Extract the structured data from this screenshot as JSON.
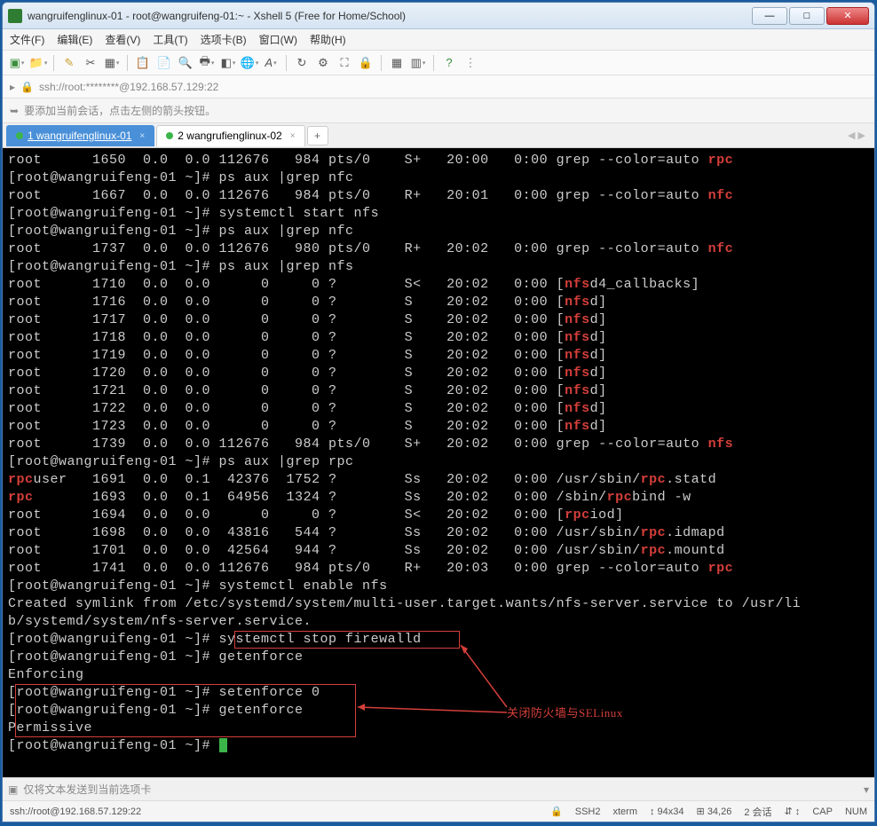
{
  "window": {
    "title": "wangruifenglinux-01 - root@wangruifeng-01:~ - Xshell 5 (Free for Home/School)"
  },
  "menu": {
    "file": "文件(F)",
    "edit": "编辑(E)",
    "view": "查看(V)",
    "tools": "工具(T)",
    "tabs": "选项卡(B)",
    "window": "窗口(W)",
    "help": "帮助(H)"
  },
  "address": {
    "url": "ssh://root:********@192.168.57.129:22"
  },
  "hint": {
    "text": "要添加当前会话，点击左侧的箭头按钮。"
  },
  "tabs": {
    "tab1": "1 wangruifenglinux-01",
    "tab2": "2 wangrufienglinux-02",
    "add": "+"
  },
  "terminal": {
    "prompt": "[root@wangruifeng-01 ~]# ",
    "lines": [
      {
        "t": "root      1650  0.0  0.0 112676   984 pts/0    S+   20:00   0:00 grep --color=auto ",
        "hl": "rpc"
      },
      {
        "t": "[root@wangruifeng-01 ~]# ps aux |grep nfc"
      },
      {
        "t": "root      1667  0.0  0.0 112676   984 pts/0    R+   20:01   0:00 grep --color=auto ",
        "hl": "nfc"
      },
      {
        "t": "[root@wangruifeng-01 ~]# systemctl start nfs"
      },
      {
        "t": "[root@wangruifeng-01 ~]# ps aux |grep nfc"
      },
      {
        "t": "root      1737  0.0  0.0 112676   980 pts/0    R+   20:02   0:00 grep --color=auto ",
        "hl": "nfc"
      },
      {
        "t": "[root@wangruifeng-01 ~]# ps aux |grep nfs"
      },
      {
        "t": "root      1710  0.0  0.0      0     0 ?        S<   20:02   0:00 [",
        "hl": "nfs",
        "t2": "d4_callbacks]"
      },
      {
        "t": "root      1716  0.0  0.0      0     0 ?        S    20:02   0:00 [",
        "hl": "nfs",
        "t2": "d]"
      },
      {
        "t": "root      1717  0.0  0.0      0     0 ?        S    20:02   0:00 [",
        "hl": "nfs",
        "t2": "d]"
      },
      {
        "t": "root      1718  0.0  0.0      0     0 ?        S    20:02   0:00 [",
        "hl": "nfs",
        "t2": "d]"
      },
      {
        "t": "root      1719  0.0  0.0      0     0 ?        S    20:02   0:00 [",
        "hl": "nfs",
        "t2": "d]"
      },
      {
        "t": "root      1720  0.0  0.0      0     0 ?        S    20:02   0:00 [",
        "hl": "nfs",
        "t2": "d]"
      },
      {
        "t": "root      1721  0.0  0.0      0     0 ?        S    20:02   0:00 [",
        "hl": "nfs",
        "t2": "d]"
      },
      {
        "t": "root      1722  0.0  0.0      0     0 ?        S    20:02   0:00 [",
        "hl": "nfs",
        "t2": "d]"
      },
      {
        "t": "root      1723  0.0  0.0      0     0 ?        S    20:02   0:00 [",
        "hl": "nfs",
        "t2": "d]"
      },
      {
        "t": "root      1739  0.0  0.0 112676   984 pts/0    S+   20:02   0:00 grep --color=auto ",
        "hl": "nfs"
      },
      {
        "t": "[root@wangruifeng-01 ~]# ps aux |grep rpc"
      },
      {
        "pre": "",
        "hl": "rpc",
        "t": "user   1691  0.0  0.1  42376  1752 ?        Ss   20:02   0:00 /usr/sbin/",
        "hl2": "rpc",
        "t2": ".statd"
      },
      {
        "pre": "",
        "hl": "rpc",
        "t": "       1693  0.0  0.1  64956  1324 ?        Ss   20:02   0:00 /sbin/",
        "hl2": "rpc",
        "t2": "bind -w"
      },
      {
        "t": "root      1694  0.0  0.0      0     0 ?        S<   20:02   0:00 [",
        "hl": "rpc",
        "t2": "iod]"
      },
      {
        "t": "root      1698  0.0  0.0  43816   544 ?        Ss   20:02   0:00 /usr/sbin/",
        "hl": "rpc",
        "t2": ".idmapd"
      },
      {
        "t": "root      1701  0.0  0.0  42564   944 ?        Ss   20:02   0:00 /usr/sbin/",
        "hl": "rpc",
        "t2": ".mountd"
      },
      {
        "t": "root      1741  0.0  0.0 112676   984 pts/0    R+   20:03   0:00 grep --color=auto ",
        "hl": "rpc"
      },
      {
        "t": "[root@wangruifeng-01 ~]# systemctl enable nfs"
      },
      {
        "t": "Created symlink from /etc/systemd/system/multi-user.target.wants/nfs-server.service to /usr/li"
      },
      {
        "t": "b/systemd/system/nfs-server.service."
      },
      {
        "t": "[root@wangruifeng-01 ~]# systemctl stop firewalld"
      },
      {
        "t": "[root@wangruifeng-01 ~]# getenforce"
      },
      {
        "t": "Enforcing"
      },
      {
        "t": "[root@wangruifeng-01 ~]# setenforce 0"
      },
      {
        "t": "[root@wangruifeng-01 ~]# getenforce"
      },
      {
        "t": "Permissive"
      },
      {
        "t": "[root@wangruifeng-01 ~]# ",
        "cursor": true
      }
    ],
    "annotation": "关闭防火墙与SELinux"
  },
  "sendbar": {
    "text": "仅将文本发送到当前选项卡"
  },
  "status": {
    "conn": "ssh://root@192.168.57.129:22",
    "proto": "SSH2",
    "term": "xterm",
    "size": "94x34",
    "pos": "34,26",
    "sessions": "2 会话",
    "cap": "CAP",
    "num": "NUM"
  },
  "icons": {
    "hint": "➥",
    "lock": "🔒",
    "send": "▣",
    "chev": "▾"
  }
}
